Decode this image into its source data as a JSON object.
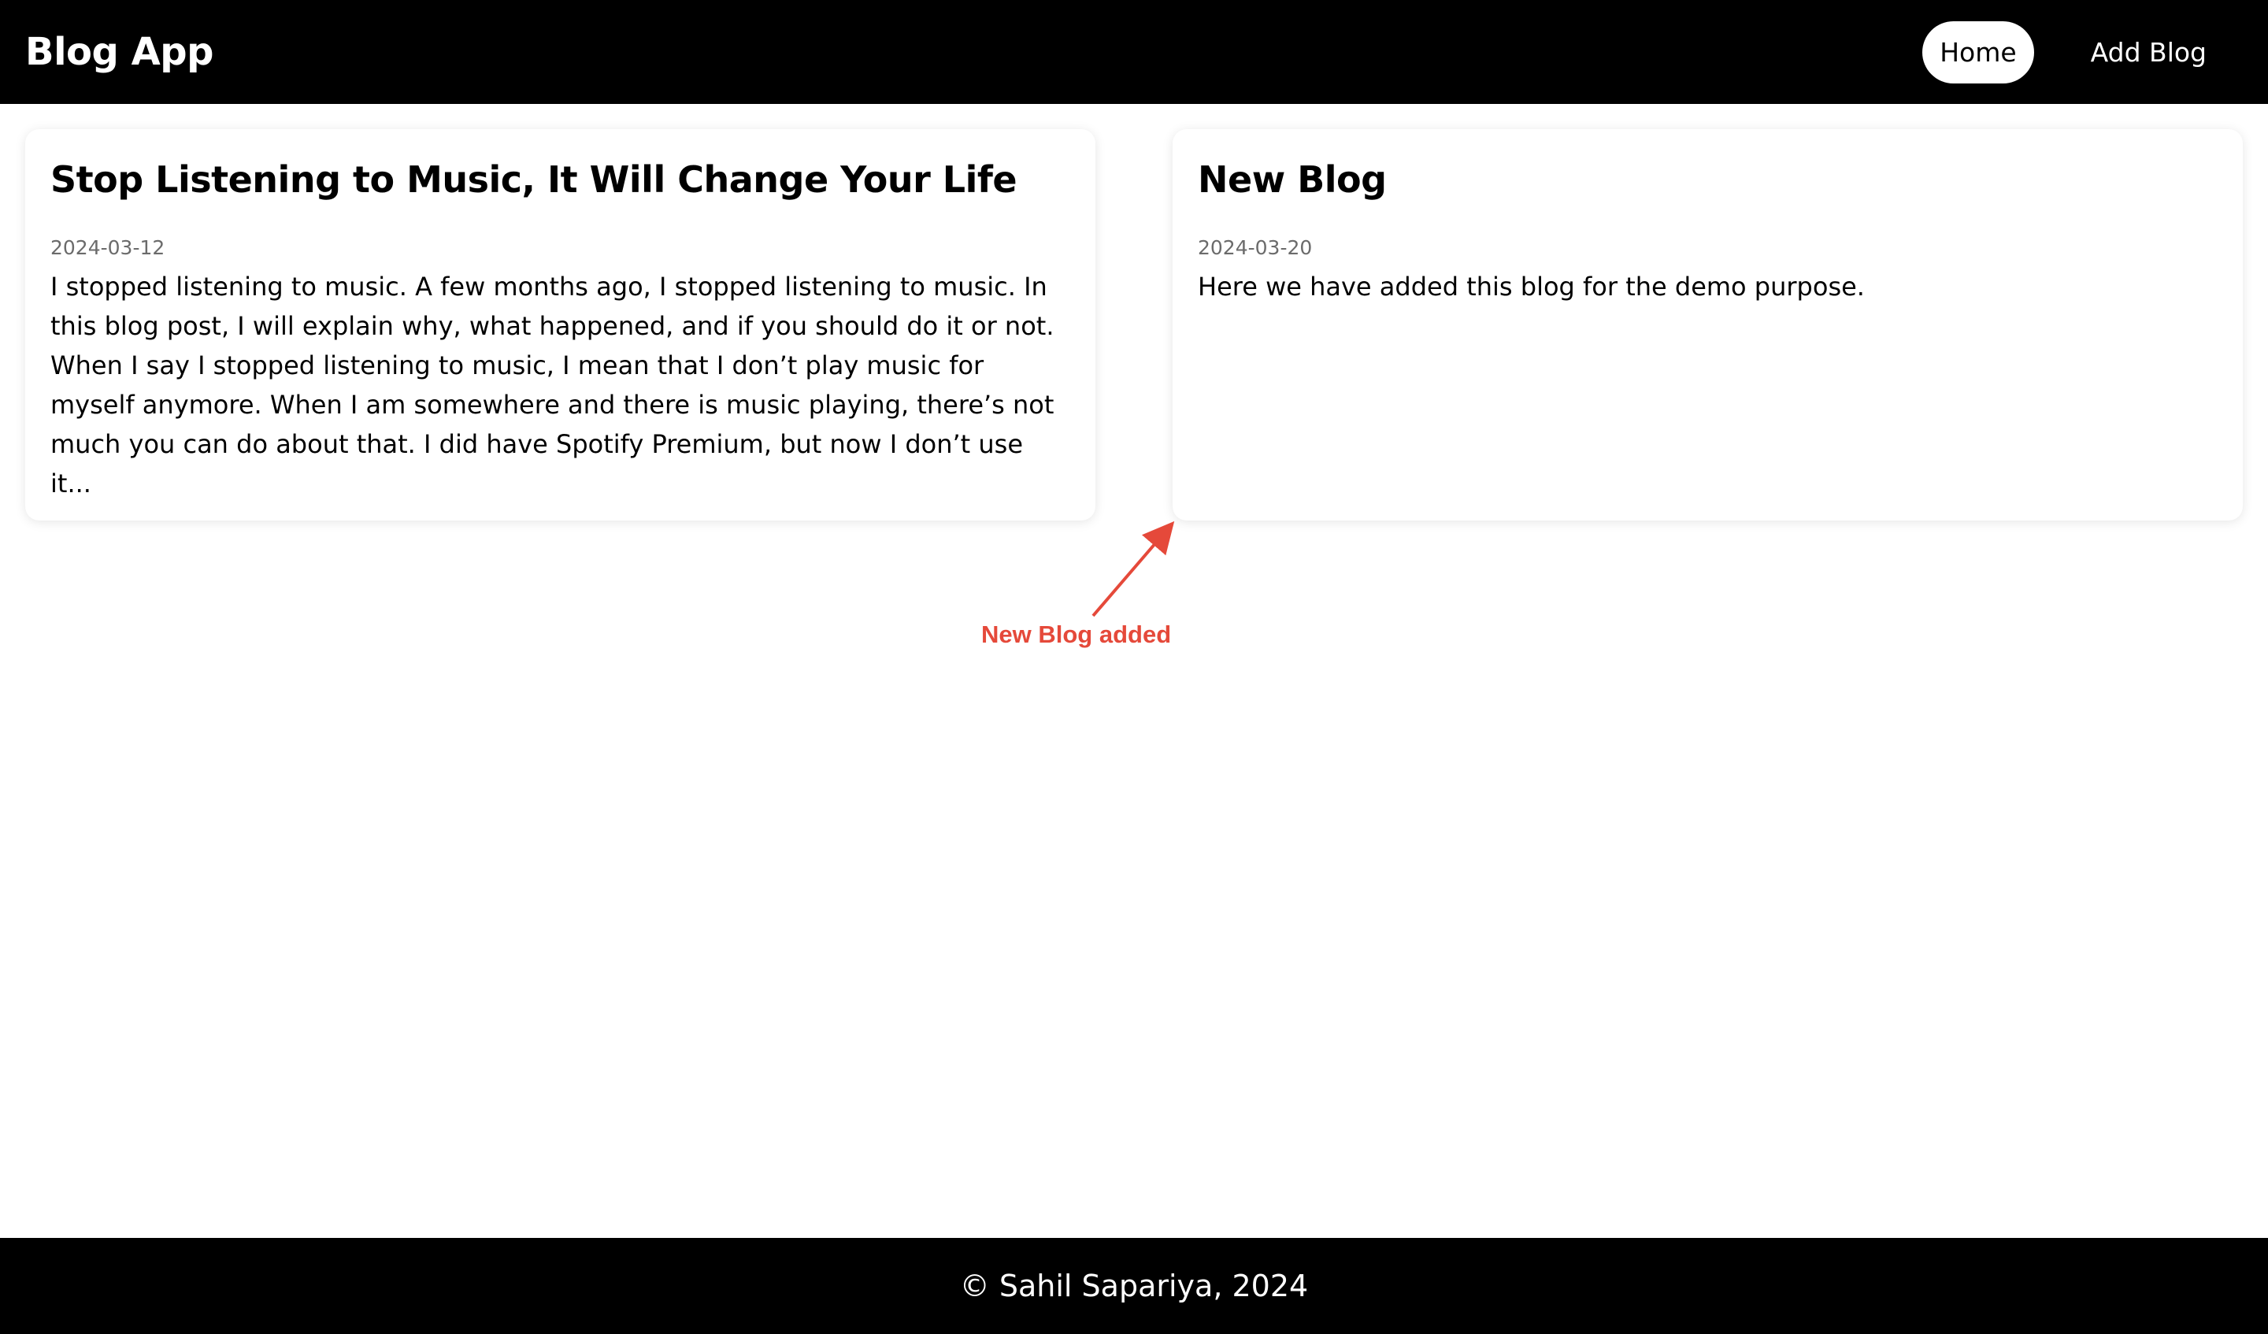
{
  "header": {
    "brand": "Blog App",
    "nav": [
      {
        "label": "Home",
        "active": true
      },
      {
        "label": "Add Blog",
        "active": false
      }
    ]
  },
  "blogs": [
    {
      "title": "Stop Listening to Music, It Will Change Your Life",
      "date": "2024-03-12",
      "excerpt": "I stopped listening to music. A few months ago, I stopped listening to music. In this blog post, I will explain why, what happened, and if you should do it or not. When I say I stopped listening to music, I mean that I don’t play music for myself anymore. When I am somewhere and there is music playing, there’s not much you can do about that. I did have Spotify Premium, but now I don’t use it..."
    },
    {
      "title": "New Blog",
      "date": "2024-03-20",
      "excerpt": "Here we have added this blog for the demo purpose."
    }
  ],
  "annotation": {
    "label": "New Blog added",
    "color": "#e5493a"
  },
  "footer": {
    "text": "© Sahil Sapariya, 2024"
  }
}
